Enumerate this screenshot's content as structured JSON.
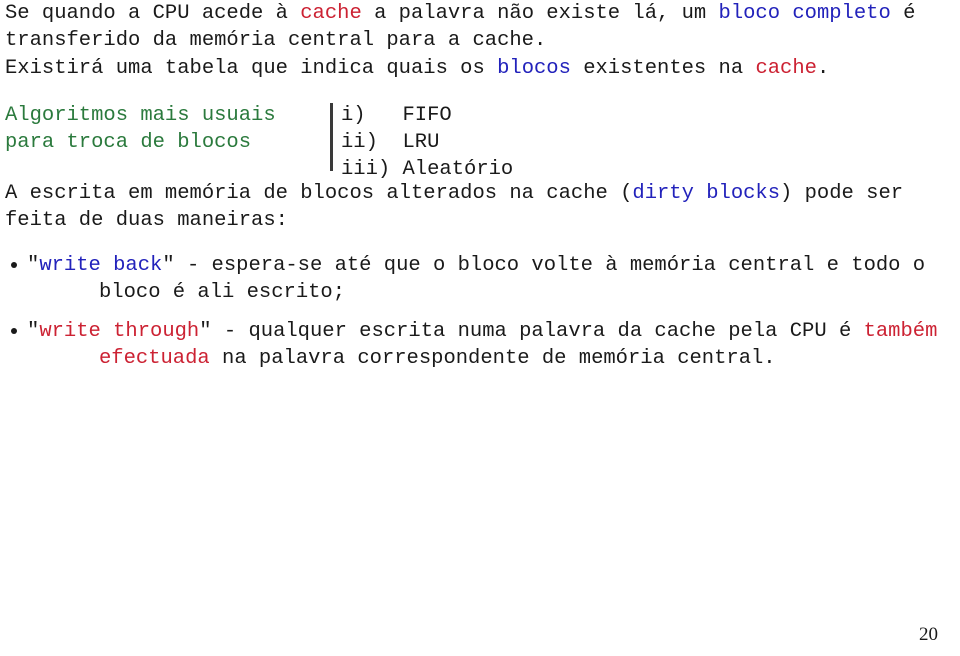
{
  "page": {
    "number": "20",
    "background_color": "#ffffff",
    "text_color": "#1a1a1a",
    "accent_red": "#cc2233",
    "accent_blue": "#2222bb",
    "accent_green": "#2b7a3d"
  },
  "paragraphs": {
    "intro": {
      "line1_a": "Se quando a CPU acede à ",
      "line1_cache": "cache",
      "line1_b": " a palavra não existe lá, um ",
      "line1_bloco": "bloco completo",
      "line1_c": " é",
      "line2": "transferido da memória central para a cache."
    },
    "table": {
      "line1_a": "Existirá uma tabela que indica quais os ",
      "line1_blocos": "blocos",
      "line1_b": " existentes na ",
      "line1_cache": "cache",
      "line1_c": "."
    },
    "write": {
      "line1_a": "A escrita em memória de blocos alterados na cache (",
      "line1_dirty": "dirty blocks",
      "line1_b": ") pode ser",
      "line2": "feita de duas maneiras:"
    }
  },
  "algorithms": {
    "label_line1": "Algoritmos mais usuais",
    "label_line2": "para troca de blocos",
    "items": [
      {
        "marker": "i)",
        "name": "FIFO"
      },
      {
        "marker": "ii)",
        "name": "LRU"
      },
      {
        "marker": "iii)",
        "name": "Aleatório"
      }
    ],
    "list_line1": "i)   FIFO",
    "list_line2": "ii)  LRU",
    "list_line3": "iii) Aleatório"
  },
  "bullets": [
    {
      "id": "write-back",
      "quote_open": "\"",
      "term": "write back",
      "quote_close": "\"",
      "line1_rest": " - espera-se até que o bloco volte à memória central e todo o",
      "line2": "bloco é ali escrito;",
      "term_color": "blue"
    },
    {
      "id": "write-through",
      "quote_open": "\"",
      "term": "write through",
      "quote_close": "\"",
      "line1_mid": " - qualquer escrita numa palavra da cache pela CPU é ",
      "line1_highlight": "também",
      "line2_highlight": "efectuada",
      "line2_rest": " na palavra correspondente de memória central.",
      "term_color": "red"
    }
  ]
}
